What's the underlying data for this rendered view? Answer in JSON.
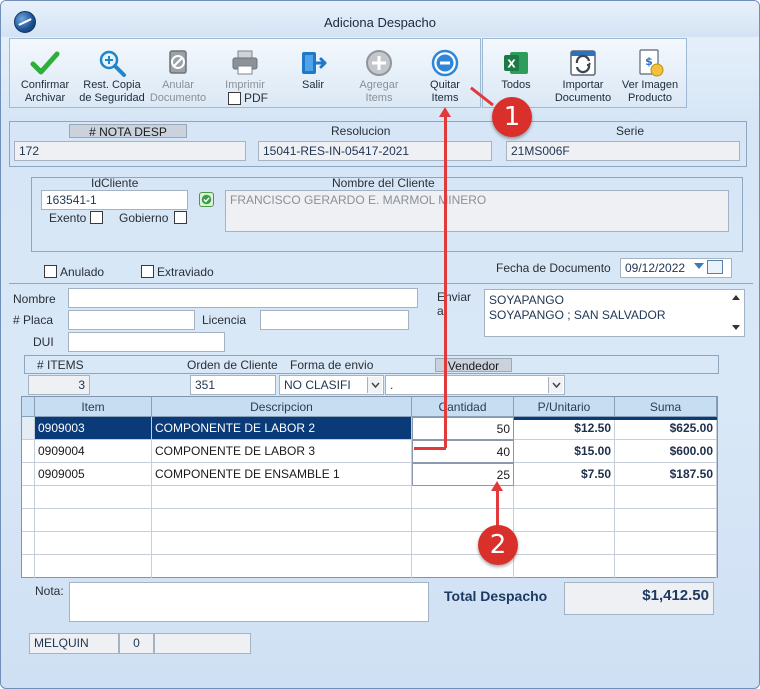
{
  "window": {
    "title": "Adiciona Despacho"
  },
  "toolbar": {
    "confirmar": "Confirmar\nArchivar",
    "rest_copia": "Rest. Copia\nde Seguridad",
    "anular": "Anular\nDocumento",
    "imprimir": "Imprimir",
    "pdf": "PDF",
    "salir": "Salir",
    "agregar": "Agregar\nItems",
    "quitar": "Quitar\nItems",
    "todos": "Todos",
    "importar": "Importar\nDocumento",
    "ver_imagen": "Ver Imagen\nProducto"
  },
  "header": {
    "nota_caption": "# NOTA DESP",
    "nota_value": "172",
    "resolucion_caption": "Resolucion",
    "resolucion_value": "15041-RES-IN-05417-2021",
    "serie_caption": "Serie",
    "serie_value": "21MS006F"
  },
  "cliente": {
    "id_caption": "IdCliente",
    "id_value": "163541-1",
    "nombre_caption": "Nombre del Cliente",
    "nombre_value": "FRANCISCO GERARDO E. MARMOL MINERO",
    "exento": "Exento",
    "gobierno": "Gobierno"
  },
  "estado": {
    "anulado": "Anulado",
    "extraviado": "Extraviado",
    "fecha_label": "Fecha de Documento",
    "fecha_value": "09/12/2022"
  },
  "envio": {
    "nombre": "Nombre",
    "placa": "# Placa",
    "licencia": "Licencia",
    "dui": "DUI",
    "enviar_a": "Enviar\na",
    "direccion_1": "SOYAPANGO",
    "direccion_2": "SOYAPANGO ; SAN SALVADOR"
  },
  "resumen": {
    "items_caption": "# ITEMS",
    "items_value": "3",
    "orden_caption": "Orden de Cliente",
    "orden_value": "351",
    "forma_caption": "Forma de envio",
    "forma_value": "NO CLASIFI",
    "vendedor_caption": "Vendedor",
    "vendedor_value": "."
  },
  "table": {
    "columns": [
      "Item",
      "Descripcion",
      "Cantidad",
      "P/Unitario",
      "Suma"
    ],
    "rows": [
      {
        "item": "0909003",
        "descripcion": "COMPONENTE DE LABOR 2",
        "cantidad": "50",
        "unitario": "$12.50",
        "suma": "$625.00"
      },
      {
        "item": "0909004",
        "descripcion": "COMPONENTE DE LABOR 3",
        "cantidad": "40",
        "unitario": "$15.00",
        "suma": "$600.00"
      },
      {
        "item": "0909005",
        "descripcion": "COMPONENTE DE ENSAMBLE 1",
        "cantidad": "25",
        "unitario": "$7.50",
        "suma": "$187.50"
      }
    ]
  },
  "footer": {
    "nota_label": "Nota:",
    "total_label": "Total Despacho",
    "total_value": "$1,412.50",
    "user": "MELQUIN",
    "user_count": "0"
  },
  "annotations": {
    "one": "1",
    "two": "2"
  },
  "colors": {
    "accent": "#0b3a78",
    "annotation": "#e23a3a"
  }
}
